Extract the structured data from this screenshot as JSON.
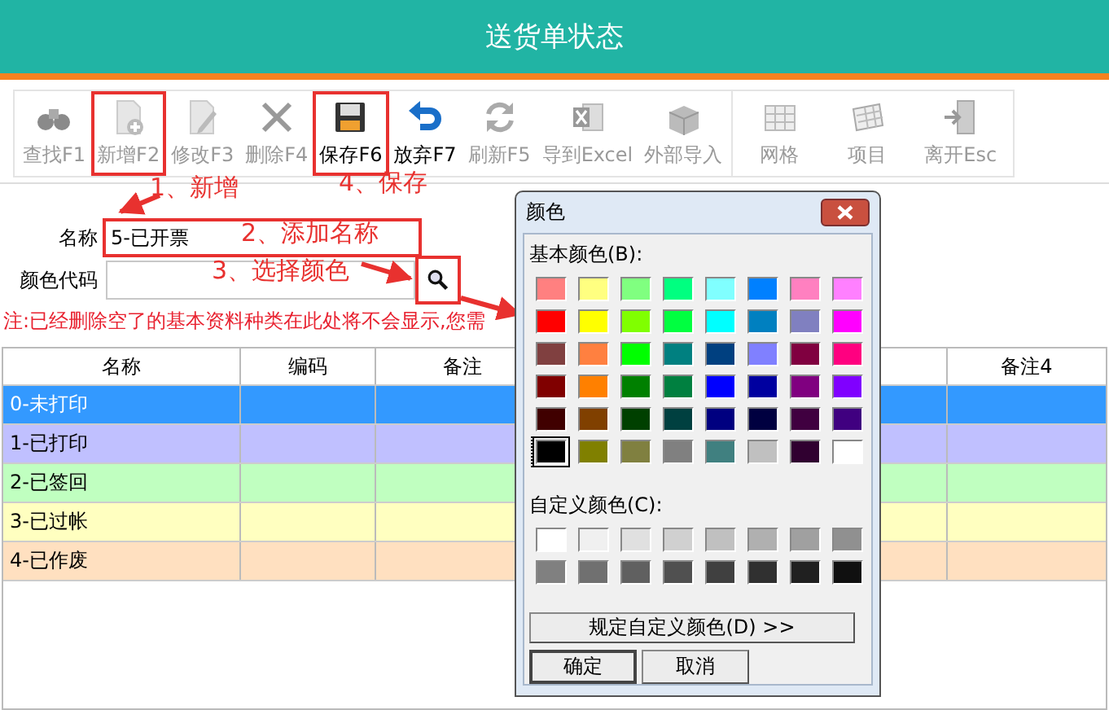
{
  "window": {
    "title": "送货单状态"
  },
  "toolbar": {
    "groups": [
      {
        "buttons": [
          {
            "label": "查找F1",
            "disabled": true,
            "highlighted": false
          },
          {
            "label": "新增F2",
            "disabled": true,
            "highlighted": true
          },
          {
            "label": "修改F3",
            "disabled": true,
            "highlighted": false
          },
          {
            "label": "删除F4",
            "disabled": true,
            "highlighted": false
          },
          {
            "label": "保存F6",
            "disabled": false,
            "highlighted": true
          },
          {
            "label": "放弃F7",
            "disabled": false,
            "highlighted": false
          },
          {
            "label": "刷新F5",
            "disabled": true,
            "highlighted": false
          },
          {
            "label": "导到Excel",
            "disabled": true,
            "highlighted": false
          },
          {
            "label": "外部导入",
            "disabled": true,
            "highlighted": false
          }
        ]
      },
      {
        "buttons": [
          {
            "label": "网格",
            "disabled": true,
            "highlighted": false
          },
          {
            "label": "项目",
            "disabled": true,
            "highlighted": false
          },
          {
            "label": "离开Esc",
            "disabled": true,
            "highlighted": false
          }
        ]
      }
    ]
  },
  "form": {
    "name_field": {
      "label": "名称",
      "value": "5-已开票",
      "highlighted": true
    },
    "color_field": {
      "label": "颜色代码",
      "search_highlighted": true
    }
  },
  "note": "注:已经删除空了的基本资料种类在此处将不会显示,您需",
  "annotations": [
    {
      "text": "1、新增",
      "kind": "new"
    },
    {
      "text": "2、添加名称",
      "kind": "name"
    },
    {
      "text": "3、选择颜色",
      "kind": "color"
    },
    {
      "text": "4、保存",
      "kind": "save"
    }
  ],
  "table": {
    "columns": [
      "名称",
      "编码",
      "备注",
      "备注4"
    ],
    "rows": [
      {
        "name": "0-未打印",
        "color": "#3399ff",
        "selected": true
      },
      {
        "name": "1-已打印",
        "color": "#c0c0ff",
        "selected": false
      },
      {
        "name": "2-已签回",
        "color": "#c0ffc0",
        "selected": false
      },
      {
        "name": "3-已过帐",
        "color": "#ffffc0",
        "selected": false
      },
      {
        "name": "4-已作废",
        "color": "#ffe0c0",
        "selected": false
      }
    ]
  },
  "color_dialog": {
    "title": "颜色",
    "basic_label": "基本颜色(B):",
    "basic_colors": [
      {
        "color": "#ff8080",
        "selected": false
      },
      {
        "color": "#ffff80",
        "selected": false
      },
      {
        "color": "#80ff80",
        "selected": false
      },
      {
        "color": "#00ff80",
        "selected": false
      },
      {
        "color": "#80ffff",
        "selected": false
      },
      {
        "color": "#0080ff",
        "selected": false
      },
      {
        "color": "#ff80c0",
        "selected": false
      },
      {
        "color": "#ff80ff",
        "selected": false
      },
      {
        "color": "#ff0000",
        "selected": false
      },
      {
        "color": "#ffff00",
        "selected": false
      },
      {
        "color": "#80ff00",
        "selected": false
      },
      {
        "color": "#00ff40",
        "selected": false
      },
      {
        "color": "#00ffff",
        "selected": false
      },
      {
        "color": "#0080c0",
        "selected": false
      },
      {
        "color": "#8080c0",
        "selected": false
      },
      {
        "color": "#ff00ff",
        "selected": false
      },
      {
        "color": "#804040",
        "selected": false
      },
      {
        "color": "#ff8040",
        "selected": false
      },
      {
        "color": "#00ff00",
        "selected": false
      },
      {
        "color": "#008080",
        "selected": false
      },
      {
        "color": "#004080",
        "selected": false
      },
      {
        "color": "#8080ff",
        "selected": false
      },
      {
        "color": "#800040",
        "selected": false
      },
      {
        "color": "#ff0080",
        "selected": false
      },
      {
        "color": "#800000",
        "selected": false
      },
      {
        "color": "#ff8000",
        "selected": false
      },
      {
        "color": "#008000",
        "selected": false
      },
      {
        "color": "#008040",
        "selected": false
      },
      {
        "color": "#0000ff",
        "selected": false
      },
      {
        "color": "#0000a0",
        "selected": false
      },
      {
        "color": "#800080",
        "selected": false
      },
      {
        "color": "#8000ff",
        "selected": false
      },
      {
        "color": "#400000",
        "selected": false
      },
      {
        "color": "#804000",
        "selected": false
      },
      {
        "color": "#004000",
        "selected": false
      },
      {
        "color": "#004040",
        "selected": false
      },
      {
        "color": "#000080",
        "selected": false
      },
      {
        "color": "#000040",
        "selected": false
      },
      {
        "color": "#400040",
        "selected": false
      },
      {
        "color": "#400080",
        "selected": false
      },
      {
        "color": "#000000",
        "selected": true
      },
      {
        "color": "#808000",
        "selected": false
      },
      {
        "color": "#808040",
        "selected": false
      },
      {
        "color": "#808080",
        "selected": false
      },
      {
        "color": "#408080",
        "selected": false
      },
      {
        "color": "#c0c0c0",
        "selected": false
      },
      {
        "color": "#300030",
        "selected": false
      },
      {
        "color": "#ffffff",
        "selected": false
      }
    ],
    "custom_label": "自定义颜色(C):",
    "custom_colors": [
      {
        "color": "#ffffff"
      },
      {
        "color": "#f0f0f0"
      },
      {
        "color": "#e0e0e0"
      },
      {
        "color": "#d0d0d0"
      },
      {
        "color": "#c0c0c0"
      },
      {
        "color": "#b0b0b0"
      },
      {
        "color": "#a0a0a0"
      },
      {
        "color": "#909090"
      },
      {
        "color": "#808080"
      },
      {
        "color": "#707070"
      },
      {
        "color": "#606060"
      },
      {
        "color": "#505050"
      },
      {
        "color": "#404040"
      },
      {
        "color": "#303030"
      },
      {
        "color": "#202020"
      },
      {
        "color": "#101010"
      }
    ],
    "define_button": "规定自定义颜色(D) >>",
    "ok_button": "确定",
    "cancel_button": "取消"
  }
}
